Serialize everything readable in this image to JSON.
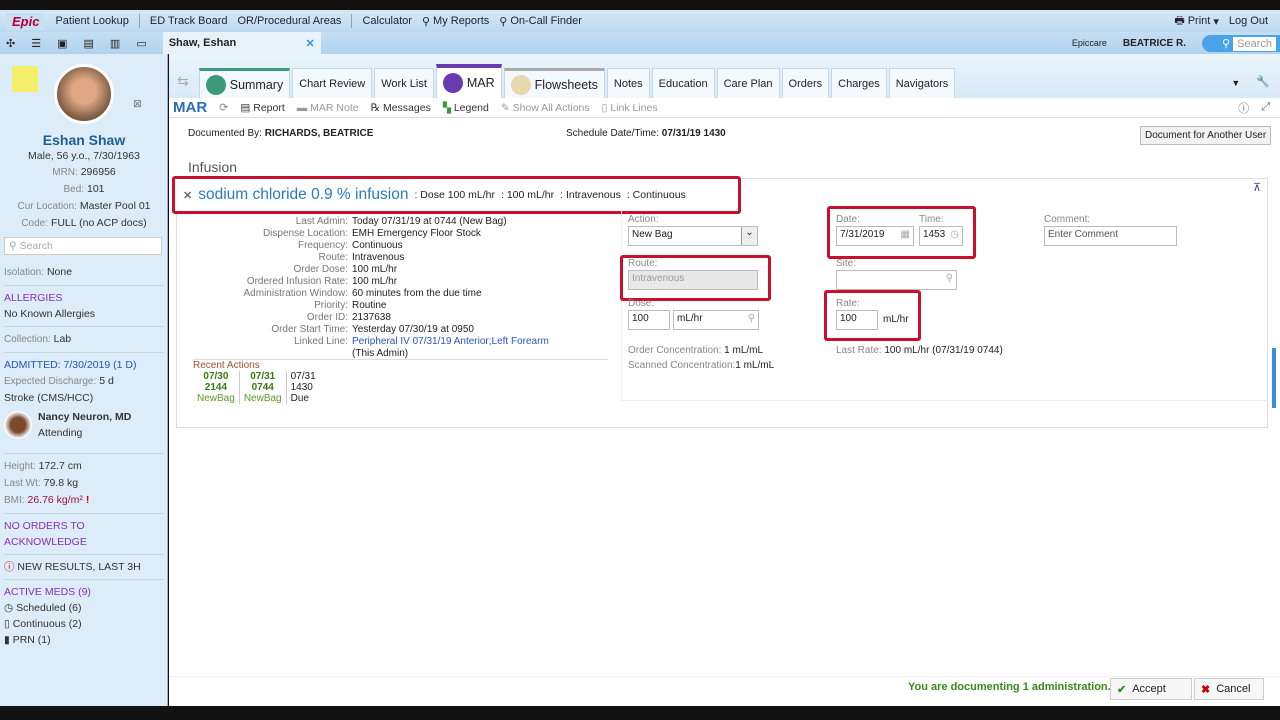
{
  "topbar": {
    "logo": "Epic",
    "items": [
      "Patient Lookup",
      "ED Track Board",
      "OR/Procedural Areas",
      "Calculator",
      "My Reports",
      "On-Call Finder"
    ],
    "print": "Print",
    "logout": "Log Out",
    "env": "Epiccare",
    "user": "BEATRICE R.",
    "search_placeholder": "Search"
  },
  "patient_tab": {
    "name": "Shaw, Eshan"
  },
  "sidebar": {
    "name": "Eshan Shaw",
    "demo": "Male, 56 y.o., 7/30/1963",
    "mrn_label": "MRN:",
    "mrn": "296956",
    "bed_label": "Bed:",
    "bed": "101",
    "loc_label": "Cur Location:",
    "loc": "Master Pool 01",
    "code_label": "Code:",
    "code": "FULL (no ACP docs)",
    "search_placeholder": "Search",
    "isolation_label": "Isolation:",
    "isolation": "None",
    "allergies_head": "ALLERGIES",
    "allergies": "No Known Allergies",
    "collection_label": "Collection:",
    "collection": "Lab",
    "admitted": "ADMITTED: 7/30/2019 (1 D)",
    "discharge_label": "Expected Discharge:",
    "discharge": "5 d",
    "dx": "Stroke (CMS/HCC)",
    "attending_name": "Nancy Neuron, MD",
    "attending_role": "Attending",
    "height_label": "Height:",
    "height": "172.7 cm",
    "wt_label": "Last Wt:",
    "wt": "79.8 kg",
    "bmi_label": "BMI:",
    "bmi": "26.76 kg/m²",
    "orders": "NO ORDERS TO ACKNOWLEDGE",
    "results": "NEW RESULTS, LAST 3H",
    "meds_head": "ACTIVE MEDS (9)",
    "meds": [
      "Scheduled (6)",
      "Continuous (2)",
      "PRN (1)"
    ]
  },
  "activity_tabs": [
    "Summary",
    "Chart Review",
    "Work List",
    "MAR",
    "Flowsheets",
    "Notes",
    "Education",
    "Care Plan",
    "Orders",
    "Charges",
    "Navigators"
  ],
  "mar_toolbar": {
    "title": "MAR",
    "items": [
      "Report",
      "MAR Note",
      "Messages",
      "Legend",
      "Show All Actions",
      "Link Lines"
    ]
  },
  "doc": {
    "by_label": "Documented By:",
    "by": "RICHARDS, BEATRICE",
    "sched_label": "Schedule Date/Time:",
    "sched": "07/31/19 1430",
    "other_user": "Document for Another User",
    "section": "Infusion"
  },
  "med": {
    "name": "sodium chloride 0.9 % infusion",
    "summary": [
      ": Dose 100 mL/hr",
      ": 100 mL/hr",
      ": Intravenous",
      ": Continuous"
    ]
  },
  "details": [
    [
      "Last Admin:",
      "Today 07/31/19 at 0744  (New Bag)"
    ],
    [
      "Dispense Location:",
      "EMH Emergency Floor Stock"
    ],
    [
      "Frequency:",
      "Continuous"
    ],
    [
      "Route:",
      "Intravenous"
    ],
    [
      "Order Dose:",
      "100 mL/hr"
    ],
    [
      "Ordered Infusion Rate:",
      "100 mL/hr"
    ],
    [
      "Administration Window:",
      "60 minutes from the due time"
    ],
    [
      "Priority:",
      "Routine"
    ],
    [
      "Order ID:",
      "2137638"
    ],
    [
      "Order Start Time:",
      "Yesterday 07/30/19 at 0950"
    ]
  ],
  "linked": {
    "label": "Linked Line:",
    "link": "Peripheral IV 07/31/19 Anterior;Left Forearm",
    "note": "(This Admin)"
  },
  "recent": {
    "title": "Recent Actions",
    "cols": [
      [
        "07/30",
        "2144",
        "NewBag"
      ],
      [
        "07/31",
        "0744",
        "NewBag"
      ],
      [
        "07/31",
        "1430",
        "Due"
      ]
    ]
  },
  "form": {
    "action_label": "Action:",
    "action": "New Bag",
    "route_label": "Route:",
    "route": "Intravenous",
    "dose_label": "Dose:",
    "dose": "100",
    "dose_unit": "mL/hr",
    "date_label": "Date:",
    "date": "7/31/2019",
    "time_label": "Time:",
    "time": "1453",
    "site_label": "Site:",
    "rate_label": "Rate:",
    "rate": "100",
    "rate_unit": "mL/hr",
    "comment_label": "Comment:",
    "comment_placeholder": "Enter Comment",
    "order_conc_label": "Order Concentration:",
    "order_conc": "1 mL/mL",
    "scan_conc_label": "Scanned Concentration:",
    "scan_conc": "1 mL/mL",
    "last_rate_label": "Last Rate:",
    "last_rate": "100 mL/hr (07/31/19 0744)"
  },
  "footer": {
    "status": "You are documenting 1 administration.",
    "accept": "Accept",
    "cancel": "Cancel"
  },
  "colors": {
    "highlight": "#c8102e",
    "accent": "#6a3ab0",
    "link": "#2a6ebb"
  }
}
